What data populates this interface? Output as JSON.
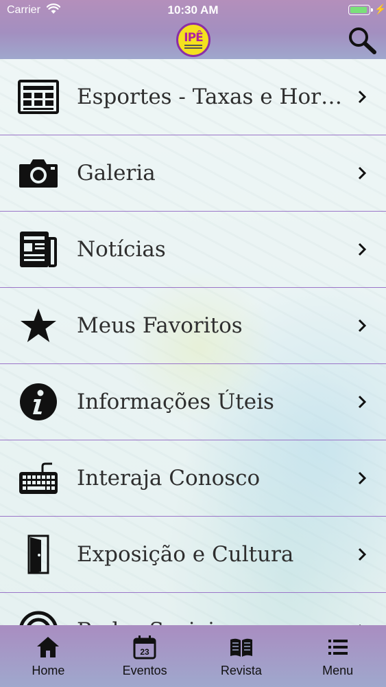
{
  "status_bar": {
    "carrier": "Carrier",
    "time": "10:30 AM"
  },
  "header": {
    "logo_text": "IPÊ",
    "search_icon": "search-icon"
  },
  "menu": {
    "items": [
      {
        "label": "Esportes - Taxas e Horários",
        "icon": "newspaper-grid-icon"
      },
      {
        "label": "Galeria",
        "icon": "camera-icon"
      },
      {
        "label": "Notícias",
        "icon": "news-icon"
      },
      {
        "label": "Meus Favoritos",
        "icon": "star-icon"
      },
      {
        "label": "Informações Úteis",
        "icon": "info-icon"
      },
      {
        "label": "Interaja Conosco",
        "icon": "keyboard-icon"
      },
      {
        "label": "Exposição e Cultura",
        "icon": "door-icon"
      },
      {
        "label": "Redes Sociais",
        "icon": "wifi-circle-icon"
      }
    ]
  },
  "tabbar": {
    "tabs": [
      {
        "label": "Home",
        "icon": "home-icon"
      },
      {
        "label": "Eventos",
        "icon": "calendar-icon",
        "badge_day": "23"
      },
      {
        "label": "Revista",
        "icon": "book-icon"
      },
      {
        "label": "Menu",
        "icon": "list-icon"
      }
    ]
  },
  "colors": {
    "header_gradient_top": "#b48fbb",
    "header_gradient_bottom": "#9fa7cd",
    "divider": "#9a74c8",
    "logo_yellow": "#f4e11f",
    "logo_purple": "#8b2fa6",
    "battery_green": "#7ae07a"
  }
}
